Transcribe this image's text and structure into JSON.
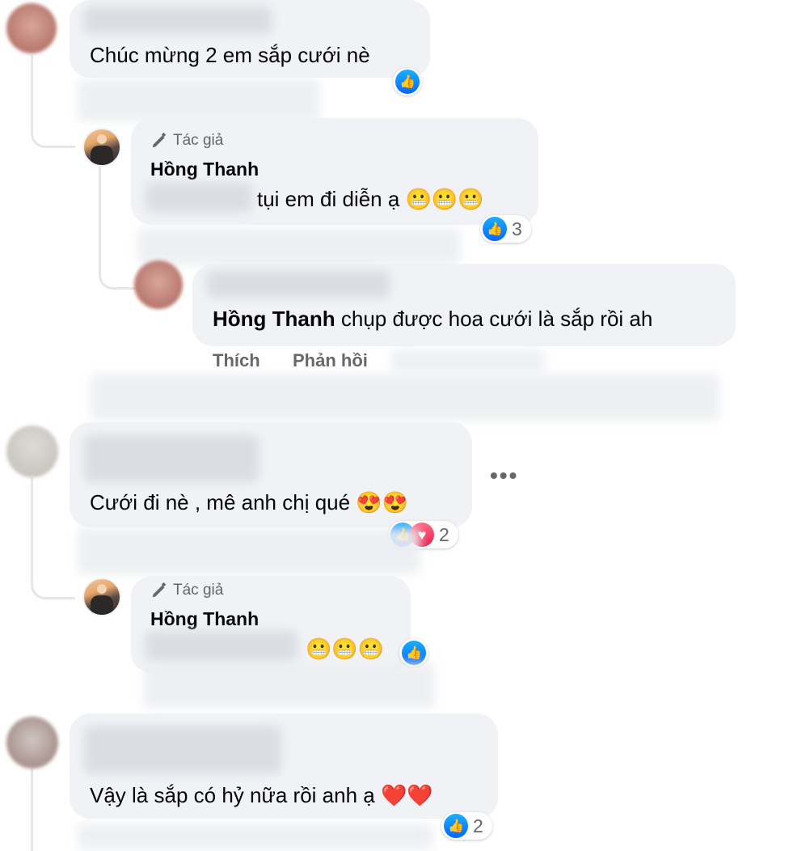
{
  "comments": [
    {
      "text": "Chúc mừng 2 em sắp cưới nè"
    },
    {
      "author_badge": "Tác giả",
      "name": "Hồng Thanh",
      "text": "tụi em đi diễn ạ",
      "emojis": "😬😬😬",
      "reaction_count": "3"
    },
    {
      "mention": "Hồng Thanh",
      "text": "chụp được hoa cưới là sắp rồi ah",
      "actions": {
        "like": "Thích",
        "reply": "Phản hồi"
      }
    },
    {
      "text": "Cưới đi nè , mê anh chị qué",
      "emojis": "😍😍",
      "reaction_count": "2",
      "more": "•••"
    },
    {
      "author_badge": "Tác giả",
      "name": "Hồng Thanh",
      "emojis": "😬😬😬"
    },
    {
      "text": "Vậy là sắp có hỷ nữa rồi anh ạ",
      "emojis": "❤️❤️",
      "reaction_count": "2"
    }
  ],
  "colors": {
    "bubble": "#f0f2f5",
    "like": "#0866ff",
    "love": "#e61e4d",
    "meta": "#65676b"
  },
  "icons": {
    "author": "pencil-icon",
    "like": "thumbs-up-icon",
    "love": "heart-icon",
    "more": "more-dots-icon"
  }
}
